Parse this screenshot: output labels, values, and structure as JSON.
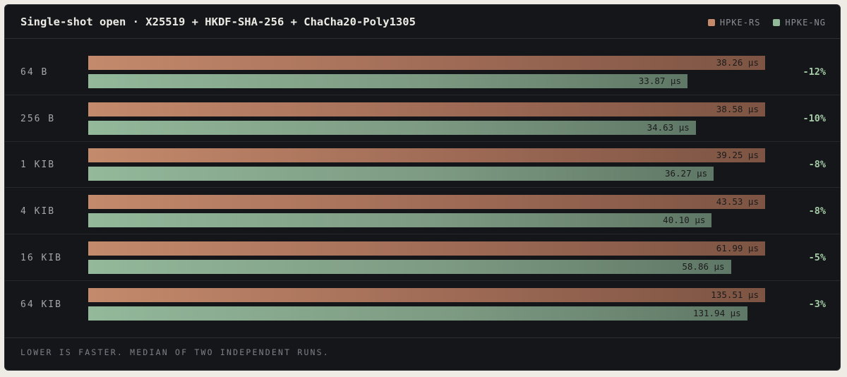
{
  "header": {
    "title": "Single-shot open · X25519 + HKDF-SHA-256 + ChaCha20-Poly1305"
  },
  "legend": [
    {
      "label": "HPKE-RS",
      "color": "#c48a6c"
    },
    {
      "label": "HPKE-NG",
      "color": "#93b89a"
    }
  ],
  "footer": {
    "note": "LOWER IS FASTER. MEDIAN OF TWO INDEPENDENT RUNS."
  },
  "chart_data": {
    "type": "bar",
    "orientation": "horizontal",
    "unit": "μs",
    "categories": [
      "64 B",
      "256 B",
      "1 KIB",
      "4 KIB",
      "16 KIB",
      "64 KIB"
    ],
    "series": [
      {
        "name": "HPKE-RS",
        "color": "#c48a6c",
        "values": [
          38.26,
          38.58,
          39.25,
          43.53,
          61.99,
          135.51
        ],
        "labels": [
          "38.26 μs",
          "38.58 μs",
          "39.25 μs",
          "43.53 μs",
          "61.99 μs",
          "135.51 μs"
        ]
      },
      {
        "name": "HPKE-NG",
        "color": "#93b89a",
        "values": [
          33.87,
          34.63,
          36.27,
          40.1,
          58.86,
          131.94
        ],
        "labels": [
          "33.87 μs",
          "34.63 μs",
          "36.27 μs",
          "40.10 μs",
          "58.86 μs",
          "131.94 μs"
        ]
      }
    ],
    "deltas": [
      "-12%",
      "-10%",
      "-8%",
      "-8%",
      "-5%",
      "-3%"
    ],
    "scale": "per-row, relative to HPKE-RS",
    "grid": false,
    "legend_position": "top-right"
  }
}
